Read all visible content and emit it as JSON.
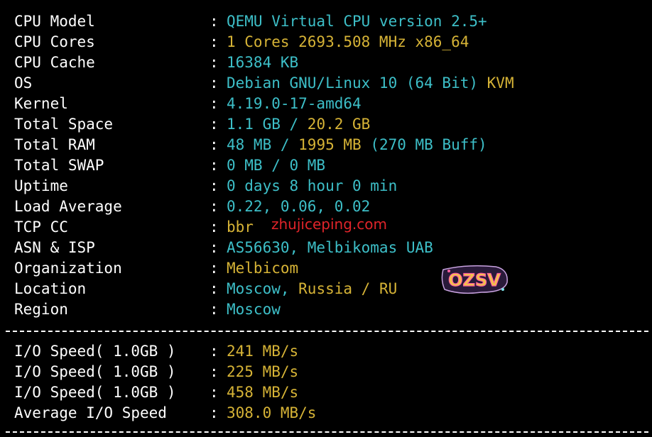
{
  "colors": {
    "background": "#000000",
    "label": "#ffffff",
    "cyan": "#3dbfc8",
    "gold": "#d6b336",
    "watermark": "#e0242a"
  },
  "system_info": [
    {
      "label": "CPU Model",
      "parts": [
        {
          "text": "QEMU Virtual CPU version 2.5+",
          "color": "cyan"
        }
      ]
    },
    {
      "label": "CPU Cores",
      "parts": [
        {
          "text": "1 Cores 2693.508 MHz x86_64",
          "color": "gold"
        }
      ]
    },
    {
      "label": "CPU Cache",
      "parts": [
        {
          "text": "16384 KB",
          "color": "cyan"
        }
      ]
    },
    {
      "label": "OS",
      "parts": [
        {
          "text": "Debian GNU/Linux 10 (64 Bit) ",
          "color": "cyan"
        },
        {
          "text": "KVM",
          "color": "gold"
        }
      ]
    },
    {
      "label": "Kernel",
      "parts": [
        {
          "text": "4.19.0-17-amd64",
          "color": "cyan"
        }
      ]
    },
    {
      "label": "Total Space",
      "parts": [
        {
          "text": "1.1 GB / ",
          "color": "cyan"
        },
        {
          "text": "20.2 GB",
          "color": "gold"
        }
      ]
    },
    {
      "label": "Total RAM",
      "parts": [
        {
          "text": "48 MB / ",
          "color": "cyan"
        },
        {
          "text": "1995 MB",
          "color": "gold"
        },
        {
          "text": " (270 MB Buff)",
          "color": "cyan"
        }
      ]
    },
    {
      "label": "Total SWAP",
      "parts": [
        {
          "text": "0 MB / 0 MB",
          "color": "cyan"
        }
      ]
    },
    {
      "label": "Uptime",
      "parts": [
        {
          "text": "0 days 8 hour 0 min",
          "color": "cyan"
        }
      ]
    },
    {
      "label": "Load Average",
      "parts": [
        {
          "text": "0.22, 0.06, 0.02",
          "color": "cyan"
        }
      ]
    },
    {
      "label": "TCP CC",
      "parts": [
        {
          "text": "bbr",
          "color": "gold"
        }
      ]
    },
    {
      "label": "ASN & ISP",
      "parts": [
        {
          "text": "AS56630, Melbikomas UAB",
          "color": "cyan"
        }
      ]
    },
    {
      "label": "Organization",
      "parts": [
        {
          "text": "Melbicom",
          "color": "gold"
        }
      ]
    },
    {
      "label": "Location",
      "parts": [
        {
          "text": "Moscow, ",
          "color": "cyan"
        },
        {
          "text": "Russia / RU",
          "color": "gold"
        }
      ]
    },
    {
      "label": "Region",
      "parts": [
        {
          "text": "Moscow",
          "color": "cyan"
        }
      ]
    }
  ],
  "io_info": [
    {
      "label": "I/O Speed( 1.0GB )",
      "parts": [
        {
          "text": "241 MB/s",
          "color": "gold"
        }
      ]
    },
    {
      "label": "I/O Speed( 1.0GB )",
      "parts": [
        {
          "text": "225 MB/s",
          "color": "gold"
        }
      ]
    },
    {
      "label": "I/O Speed( 1.0GB )",
      "parts": [
        {
          "text": "458 MB/s",
          "color": "gold"
        }
      ]
    },
    {
      "label": "Average I/O Speed",
      "parts": [
        {
          "text": "308.0 MB/s",
          "color": "gold"
        }
      ]
    }
  ],
  "separator": ":",
  "watermarks": {
    "site": "zhujiceping.com",
    "logo": "OZSV"
  }
}
